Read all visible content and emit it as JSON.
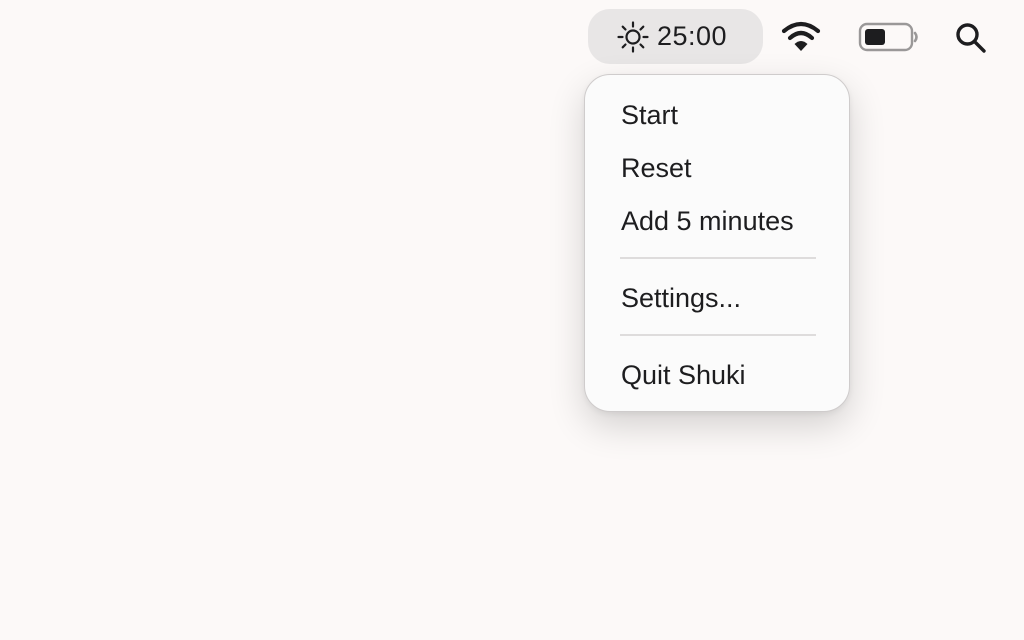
{
  "menubar": {
    "timer": {
      "icon": "sun-icon",
      "time": "25:00"
    },
    "status_icons": [
      "wifi-icon",
      "battery-icon",
      "search-icon"
    ]
  },
  "menu": {
    "items": [
      {
        "label": "Start"
      },
      {
        "label": "Reset"
      },
      {
        "label": "Add 5 minutes"
      },
      {
        "label": "Settings..."
      },
      {
        "label": "Quit Shuki"
      }
    ]
  },
  "colors": {
    "background": "#fcf9f8",
    "timer_pill": "#e8e6e6",
    "text": "#1d1d1f",
    "separator": "#dedcdc"
  }
}
